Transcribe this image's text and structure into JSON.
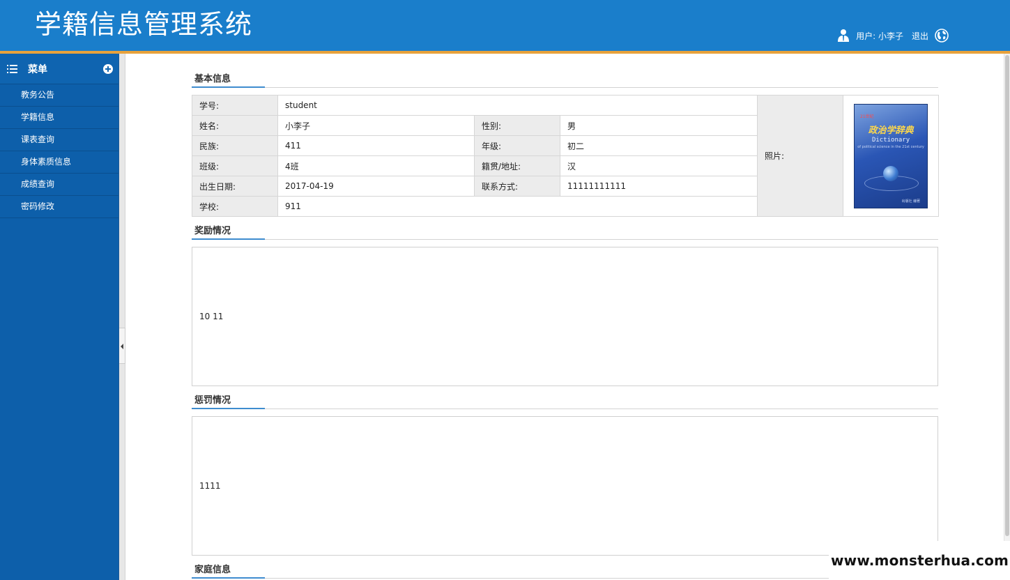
{
  "header": {
    "title": "学籍信息管理系统",
    "user_label": "用户: 小李子",
    "logout": "退出"
  },
  "sidebar": {
    "heading": "菜单",
    "items": [
      {
        "label": "教务公告"
      },
      {
        "label": "学籍信息"
      },
      {
        "label": "课表查询"
      },
      {
        "label": "身体素质信息"
      },
      {
        "label": "成绩查询"
      },
      {
        "label": "密码修改"
      }
    ]
  },
  "basic_info": {
    "section_title": "基本信息",
    "student_id_label": "学号:",
    "student_id": "student",
    "name_label": "姓名:",
    "name": "小李子",
    "gender_label": "性别:",
    "gender": "男",
    "ethnicity_label": "民族:",
    "ethnicity": "411",
    "grade_label": "年级:",
    "grade": "初二",
    "class_label": "班级:",
    "class": "4班",
    "origin_label": "籍贯/地址:",
    "origin": "汉",
    "birth_label": "出生日期:",
    "birth": "2017-04-19",
    "contact_label": "联系方式:",
    "contact": "11111111111",
    "school_label": "学校:",
    "school": "911",
    "photo_label": "照片:",
    "photo_book": {
      "top_text": "21世纪",
      "title": "政治学辞典",
      "en_title": "Dictionary",
      "en_sub": "of political science in the 21st century",
      "author": "出版社 编著"
    }
  },
  "rewards": {
    "section_title": "奖励情况",
    "content": "10 11"
  },
  "punishments": {
    "section_title": "惩罚情况",
    "content": "1111"
  },
  "family": {
    "section_title": "家庭信息"
  },
  "watermark": "www.monsterhua.com"
}
